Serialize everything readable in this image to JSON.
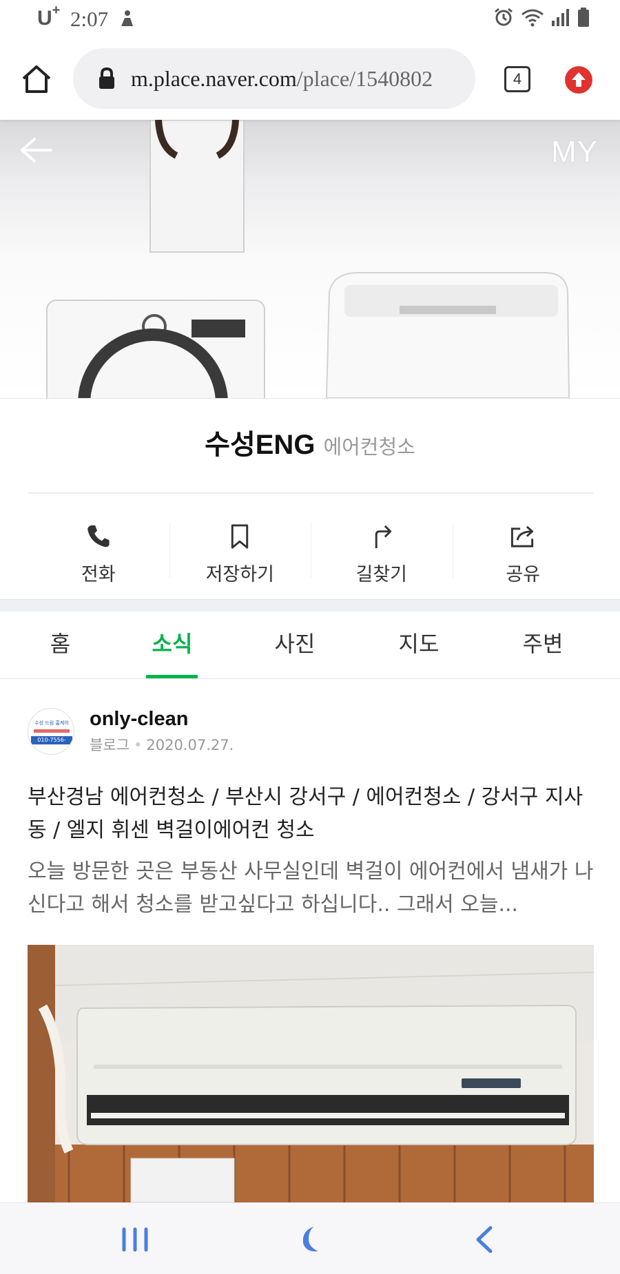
{
  "status_bar": {
    "carrier": "U",
    "carrier_sup": "+",
    "time": "2:07"
  },
  "browser": {
    "url_host": "m.place.naver.com",
    "url_path": "/place/1540802",
    "tab_count": "4"
  },
  "hero": {
    "my_label": "MY"
  },
  "place": {
    "name": "수성ENG",
    "category": "에어컨청소",
    "actions": [
      {
        "label": "전화",
        "icon": "phone-icon"
      },
      {
        "label": "저장하기",
        "icon": "bookmark-icon"
      },
      {
        "label": "길찾기",
        "icon": "directions-icon"
      },
      {
        "label": "공유",
        "icon": "share-icon"
      }
    ]
  },
  "tabs": [
    {
      "label": "홈",
      "active": false
    },
    {
      "label": "소식",
      "active": true
    },
    {
      "label": "사진",
      "active": false
    },
    {
      "label": "지도",
      "active": false
    },
    {
      "label": "주변",
      "active": false
    }
  ],
  "post": {
    "author": "only-clean",
    "source": "블로그",
    "date": "2020.07.27.",
    "title": "부산경남 에어컨청소 / 부산시 강서구 / 에어컨청소 / 강서구 지사동 / 엘지 휘센 벽걸이에어컨 청소",
    "body": "오늘 방문한 곳은 부동산 사무실인데 벽걸이 에어컨에서 냄새가 나신다고 해서 청소를 받고싶다고 하십니다.. 그래서 오늘...",
    "avatar_phone": "010-7556-4878",
    "avatar_brand": "수성 드림 홈케어"
  },
  "colors": {
    "accent_green": "#03b34a",
    "update_red": "#e0322e"
  }
}
